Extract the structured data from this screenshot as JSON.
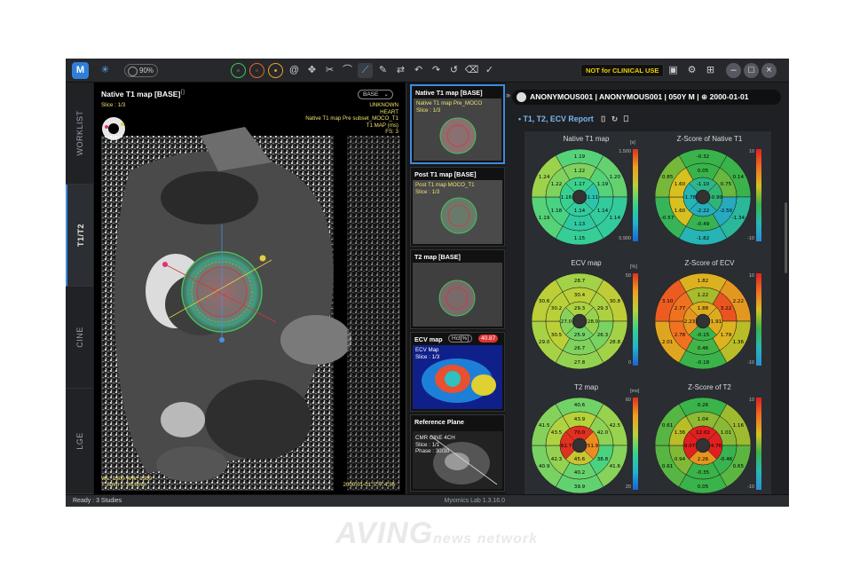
{
  "app": {
    "toolbar": {
      "zoom": "90%",
      "not_clinical": "NOT for CLINICAL USE"
    },
    "side_tabs": [
      "WORKLIST",
      "T1/T2",
      "CINE",
      "LGE"
    ],
    "active_tab": "T1/T2",
    "viewer": {
      "title": "Native T1 map [BASE]",
      "base_select": "BASE",
      "slice": "Slice : 1/3",
      "overlay_right": [
        "UNKNOWN",
        "HEART",
        "Native T1 map Pre subset_MOCO_T1",
        "T1 MAP (ms)",
        "FS: 3"
      ],
      "overlay_bl_1": "WL: 1300  WW: 1350",
      "overlay_bl_2": "T: 8mm   L: 86.6mm",
      "overlay_br": "2000-01-01 오후 4:36"
    },
    "thumbnails": [
      {
        "title": "Native T1 map [BASE]",
        "line1": "Native T1 map Pre_MOCO",
        "line2": "Slice : 1/3"
      },
      {
        "title": "Post T1 map [BASE]",
        "line1": "Post T1 map MOCO_T1",
        "line2": "Slice : 1/3"
      },
      {
        "title": "T2 map [BASE]",
        "line1": "",
        "line2": ""
      },
      {
        "title": "ECV map",
        "btn": "Hct[%]",
        "badge": "40.87",
        "line1": "ECV Map",
        "line2": "Slice : 1/3"
      },
      {
        "title": "Reference Plane",
        "line1": "CMR CINE 4CH",
        "line2": "Slice : 1/1",
        "line3": "Phase : 30/30"
      }
    ],
    "status_left": "Ready : 3 Studies",
    "version": "Myomics Lab 1.3.16.0"
  },
  "report": {
    "patient": "ANONYMOUS001 | ANONYMOUS001 | 050Y M | ⊕ 2000-01-01",
    "title": "T1, T2, ECV Report",
    "charts": [
      {
        "label": "Native T1 map",
        "unit": "[s]",
        "scale_max": "1.500",
        "scale_min": "0.900",
        "scale": "jet",
        "outer": [
          "1.19",
          "1.20",
          "1.14",
          "1.15",
          "1.19",
          "1.24"
        ],
        "mid": [
          "1.22",
          "1.19",
          "1.14",
          "1.13",
          "1.18",
          "1.22"
        ],
        "inner": [
          "1.17",
          "1.11",
          "1.14",
          "1.16"
        ]
      },
      {
        "label": "Z-Score of Native T1",
        "unit": "",
        "scale_max": "10",
        "scale_min": "-10",
        "scale": "z",
        "outer": [
          "-0.32",
          "0.14",
          "-1.34",
          "-1.82",
          "-0.57",
          "0.85"
        ],
        "mid": [
          "0.05",
          "0.75",
          "-2.50",
          "-0.49",
          "1.60",
          "1.60"
        ],
        "inner": [
          "-1.10",
          "-0.90",
          "-2.22",
          "-1.78"
        ]
      },
      {
        "label": "ECV map",
        "unit": "[%]",
        "scale_max": "50",
        "scale_min": "0",
        "scale": "jet",
        "outer": [
          "28.7",
          "30.8",
          "28.8",
          "27.8",
          "29.0",
          "30.6"
        ],
        "mid": [
          "30.4",
          "29.3",
          "26.3",
          "26.7",
          "30.5",
          "30.2"
        ],
        "inner": [
          "29.3",
          "28.0",
          "25.9",
          "27.0"
        ]
      },
      {
        "label": "Z-Score of ECV",
        "unit": "",
        "scale_max": "10",
        "scale_min": "-10",
        "scale": "z",
        "outer": [
          "1.82",
          "2.22",
          "1.36",
          "-0.18",
          "2.01",
          "3.10"
        ],
        "mid": [
          "1.22",
          "3.22",
          "1.79",
          "0.46",
          "2.78",
          "2.77"
        ],
        "inner": [
          "1.88",
          "1.91",
          "-0.15",
          "2.23"
        ]
      },
      {
        "label": "T2 map",
        "unit": "[ms]",
        "scale_max": "60",
        "scale_min": "20",
        "scale": "jet",
        "outer": [
          "40.6",
          "42.5",
          "41.6",
          "39.9",
          "40.9",
          "41.5"
        ],
        "mid": [
          "43.9",
          "42.0",
          "38.8",
          "40.2",
          "42.3",
          "43.5"
        ],
        "inner": [
          "70.0",
          "51.9",
          "45.6",
          "62.7"
        ]
      },
      {
        "label": "Z-Score of T2",
        "unit": "",
        "scale_max": "10",
        "scale_min": "-10",
        "scale": "z",
        "outer": [
          "0.26",
          "1.16",
          "0.65",
          "0.05",
          "0.61",
          "0.61"
        ],
        "mid": [
          "1.04",
          "1.01",
          "-0.46",
          "-0.35",
          "0.94",
          "1.36"
        ],
        "inner": [
          "12.02",
          "4.76",
          "2.26",
          "9.07"
        ]
      }
    ]
  }
}
